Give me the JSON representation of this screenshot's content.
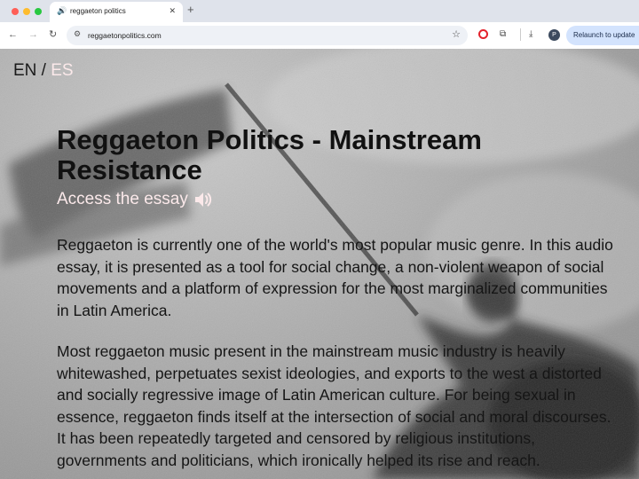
{
  "browser": {
    "tab_title": "reggaeton politics",
    "url": "reggaetonpolitics.com",
    "relaunch_label": "Relaunch to update",
    "profile_initial": "P"
  },
  "site": {
    "lang_en": "EN",
    "lang_sep": " / ",
    "lang_es": "ES",
    "title": "Reggaeton Politics - Mainstream Resistance",
    "access_label": "Access the essay",
    "paragraphs": [
      "Reggaeton is currently one of the world's most popular music genre. In this audio essay, it is presented as a tool for social change, a non-violent weapon of social movements and a platform of expression for the most marginalized communities in Latin America.",
      "Most reggaeton music present in the mainstream music industry is heavily whitewashed, perpetuates sexist ideologies, and exports to the west a distorted and socially regressive image of Latin American culture. For being sexual in essence, reggaeton finds itself at the intersection of social and moral discourses. It has been repeatedly targeted and censored by religious institutions, governments and politicians, which ironically helped its rise and reach."
    ]
  },
  "colors": {
    "accent_pink": "#fbe9ea",
    "text_dark": "#111111"
  }
}
